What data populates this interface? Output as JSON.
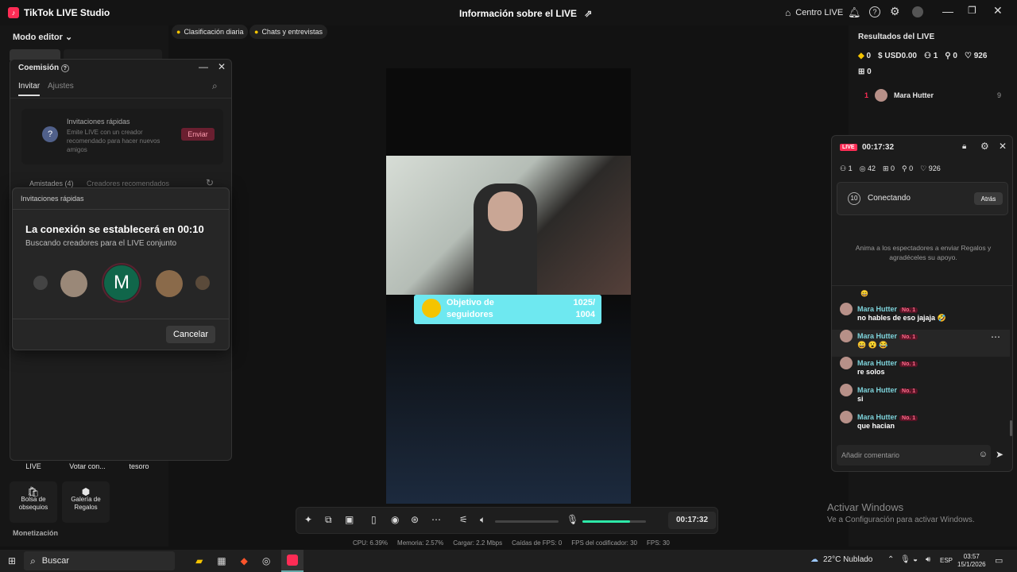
{
  "titlebar": {
    "app": "TikTok LIVE Studio",
    "center": "Información sobre el LIVE",
    "centro": "Centro LIVE"
  },
  "left": {
    "mode": "Modo editor",
    "chips": [
      "Clasificación diaria",
      "Chats y entrevistas"
    ],
    "tools_row": [
      "LIVE",
      "Votar con...",
      "tesoro"
    ],
    "tools": [
      {
        "label1": "Bolsa de",
        "label2": "obsequios"
      },
      {
        "label1": "Galería de",
        "label2": "Regalos"
      }
    ],
    "monetizacion": "Monetización"
  },
  "coemision": {
    "title": "Coemisión",
    "tabs": [
      "Invitar",
      "Ajustes"
    ],
    "quick_title": "Invitaciones rápidas",
    "quick_desc": "Emite LIVE con un creador recomendado para hacer nuevos amigos",
    "send": "Enviar",
    "friends_tab": "Amistades (4)",
    "recommended_tab": "Creadores recomendados"
  },
  "quick": {
    "header": "Invitaciones rápidas",
    "heading": "La conexión se establecerá en 00:10",
    "sub": "Buscando creadores para el LIVE conjunto",
    "center_letter": "M",
    "cancel": "Cancelar"
  },
  "goal": {
    "label1": "Objetivo de",
    "label2": "seguidores",
    "value1": "1025/",
    "value2": "1004"
  },
  "controls": {
    "time": "00:17:32",
    "mic_level": 0.75
  },
  "stats": [
    "CPU: 6.39%",
    "Memoria: 2.57%",
    "Cargar: 2.2 Mbps",
    "Caídas de FPS: 0",
    "FPS del codificador: 30",
    "FPS: 30"
  ],
  "results": {
    "title": "Resultados del LIVE",
    "coins": "0",
    "usd": "USD0.00",
    "viewers": "1",
    "shares": "0",
    "likes": "926",
    "gifts": "0",
    "rank": {
      "pos": "1",
      "name": "Mara Hutter",
      "score": "9"
    }
  },
  "live": {
    "badge": "LIVE",
    "time": "00:17:32",
    "viewers": "1",
    "views": "42",
    "gifts": "0",
    "follows": "0",
    "likes": "926",
    "connecting": "Conectando",
    "connect_count": "10",
    "back": "Atrás",
    "prompt": "Anima a los espectadores a enviar Regalos y agradéceles su apoyo.",
    "messages": [
      {
        "name": "Mara Hutter",
        "text": "no hables de eso jajaja 🤣"
      },
      {
        "name": "Mara Hutter",
        "text": "😄 😮 😂"
      },
      {
        "name": "Mara Hutter",
        "text": "re solos"
      },
      {
        "name": "Mara Hutter",
        "text": "si"
      },
      {
        "name": "Mara Hutter",
        "text": "que hacian"
      }
    ],
    "badge_text": "No. 1",
    "comment_placeholder": "Añadir comentario"
  },
  "windows": {
    "activate": "Activar Windows",
    "activate_sub": "Ve a Configuración para activar Windows."
  },
  "taskbar": {
    "search": "Buscar",
    "weather": "22°C  Nublado",
    "lang": "ESP",
    "time": "03:57",
    "date": "15/1/2026"
  }
}
